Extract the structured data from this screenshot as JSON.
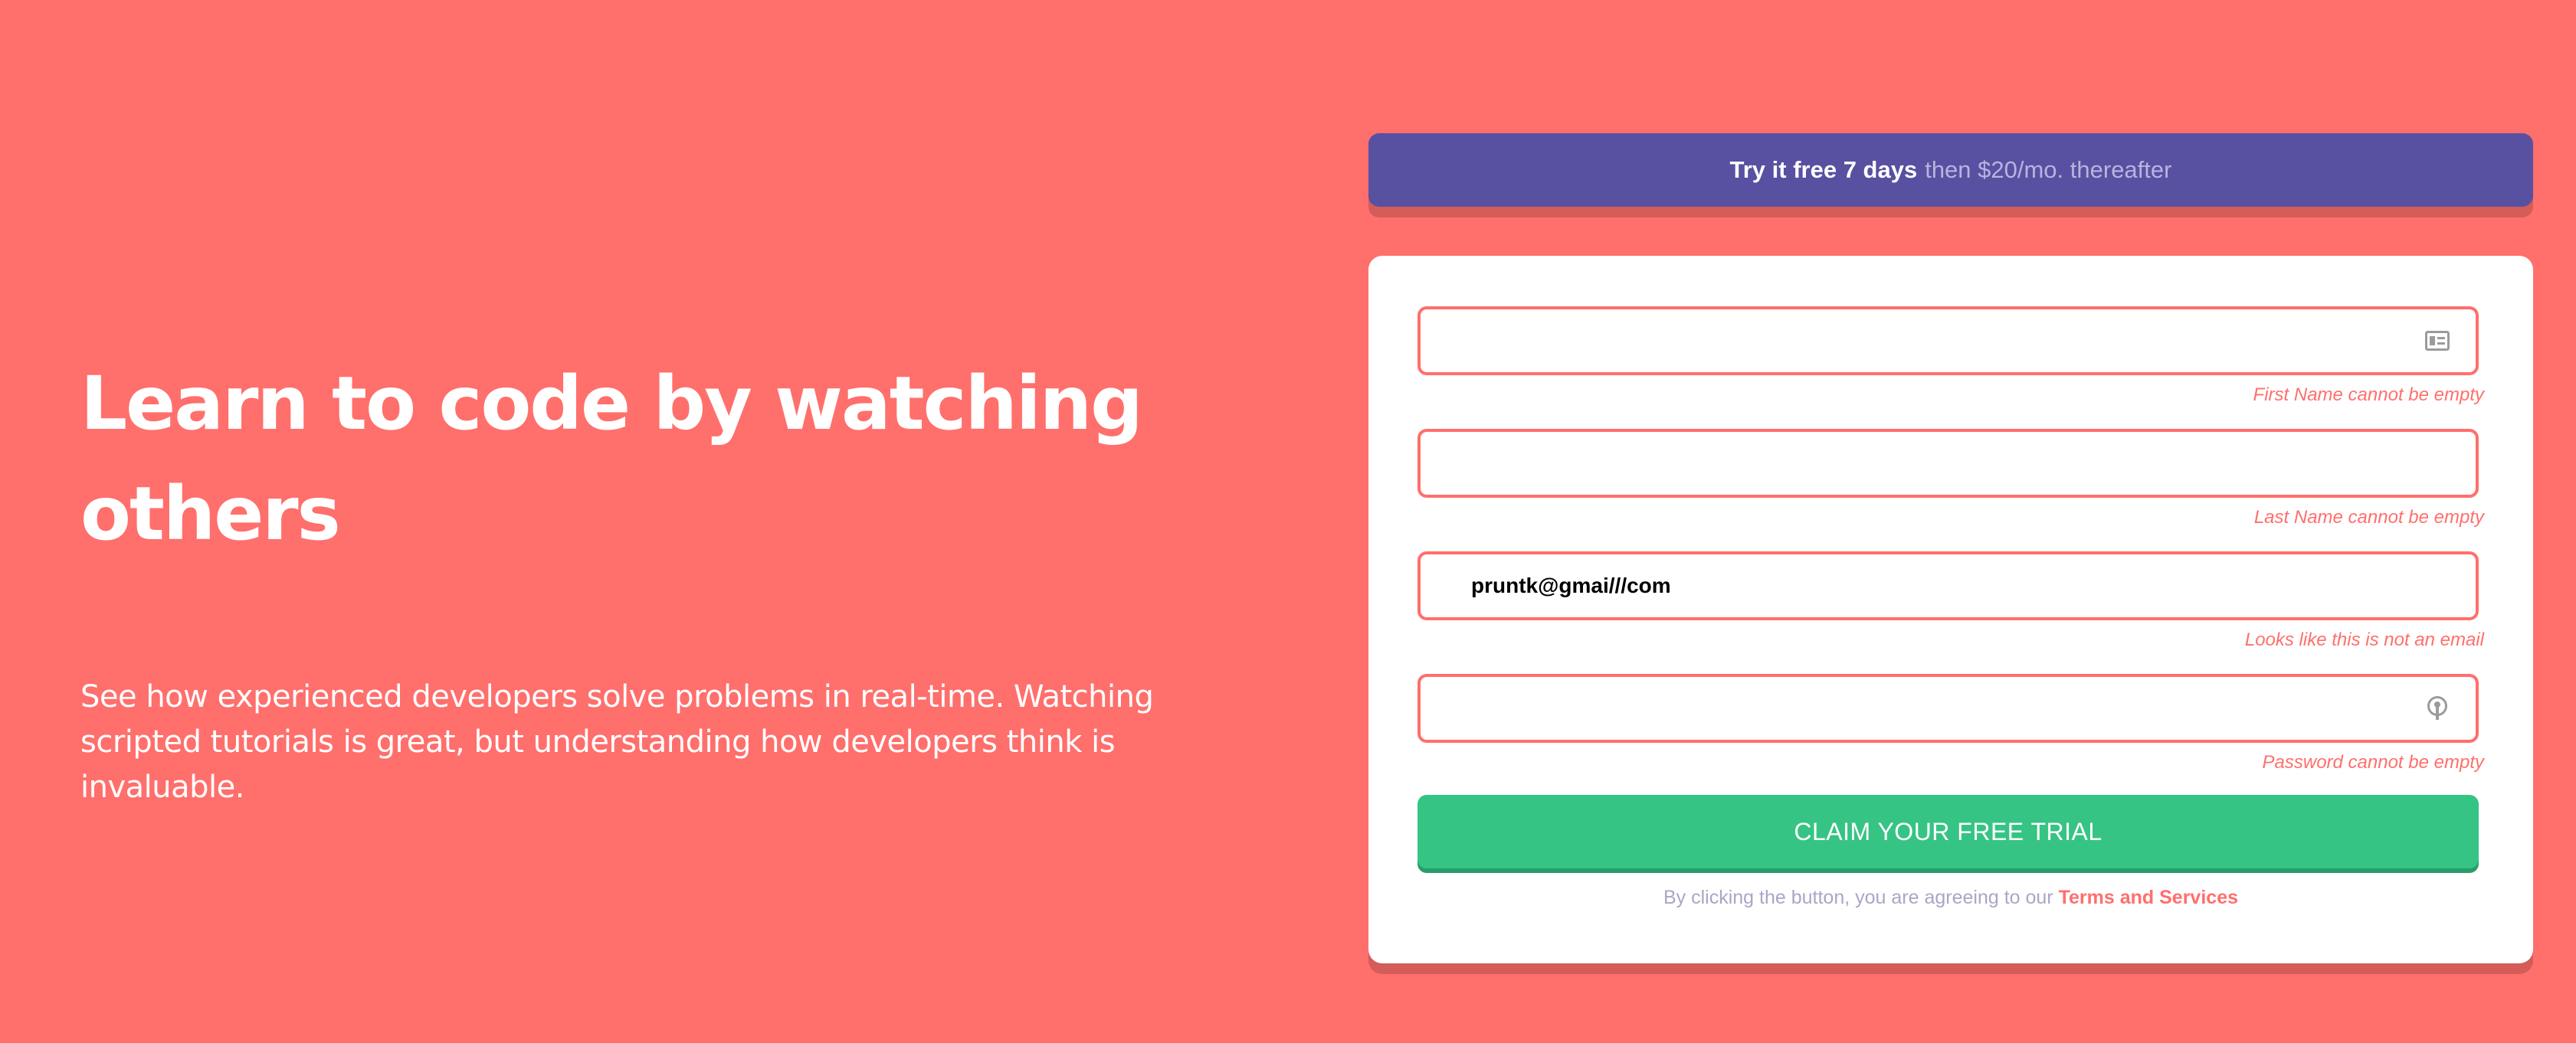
{
  "hero": {
    "title": "Learn to code by watching others",
    "description": "See how experienced developers solve problems in real-time. Watching scripted tutorials is great, but understanding how developers think is invaluable."
  },
  "promo": {
    "strong": "Try it free 7 days",
    "rest": "then $20/mo. thereafter"
  },
  "form": {
    "first_name": {
      "value": "",
      "error": "First Name cannot be empty",
      "icon": "error-icon"
    },
    "last_name": {
      "value": "",
      "error": "Last Name cannot be empty"
    },
    "email": {
      "value": "pruntk@gmai///com",
      "error": "Looks like this is not an email"
    },
    "password": {
      "value": "",
      "error": "Password cannot be empty",
      "icon": "error-icon"
    },
    "submit_label": "CLAIM YOUR FREE TRIAL",
    "terms_prefix": "By clicking the button, you are agreeing to our",
    "terms_link": "Terms and Services"
  },
  "colors": {
    "background": "#ff6f6c",
    "promo": "#5850a0",
    "button": "#36c485",
    "error": "#ff6f6c"
  }
}
